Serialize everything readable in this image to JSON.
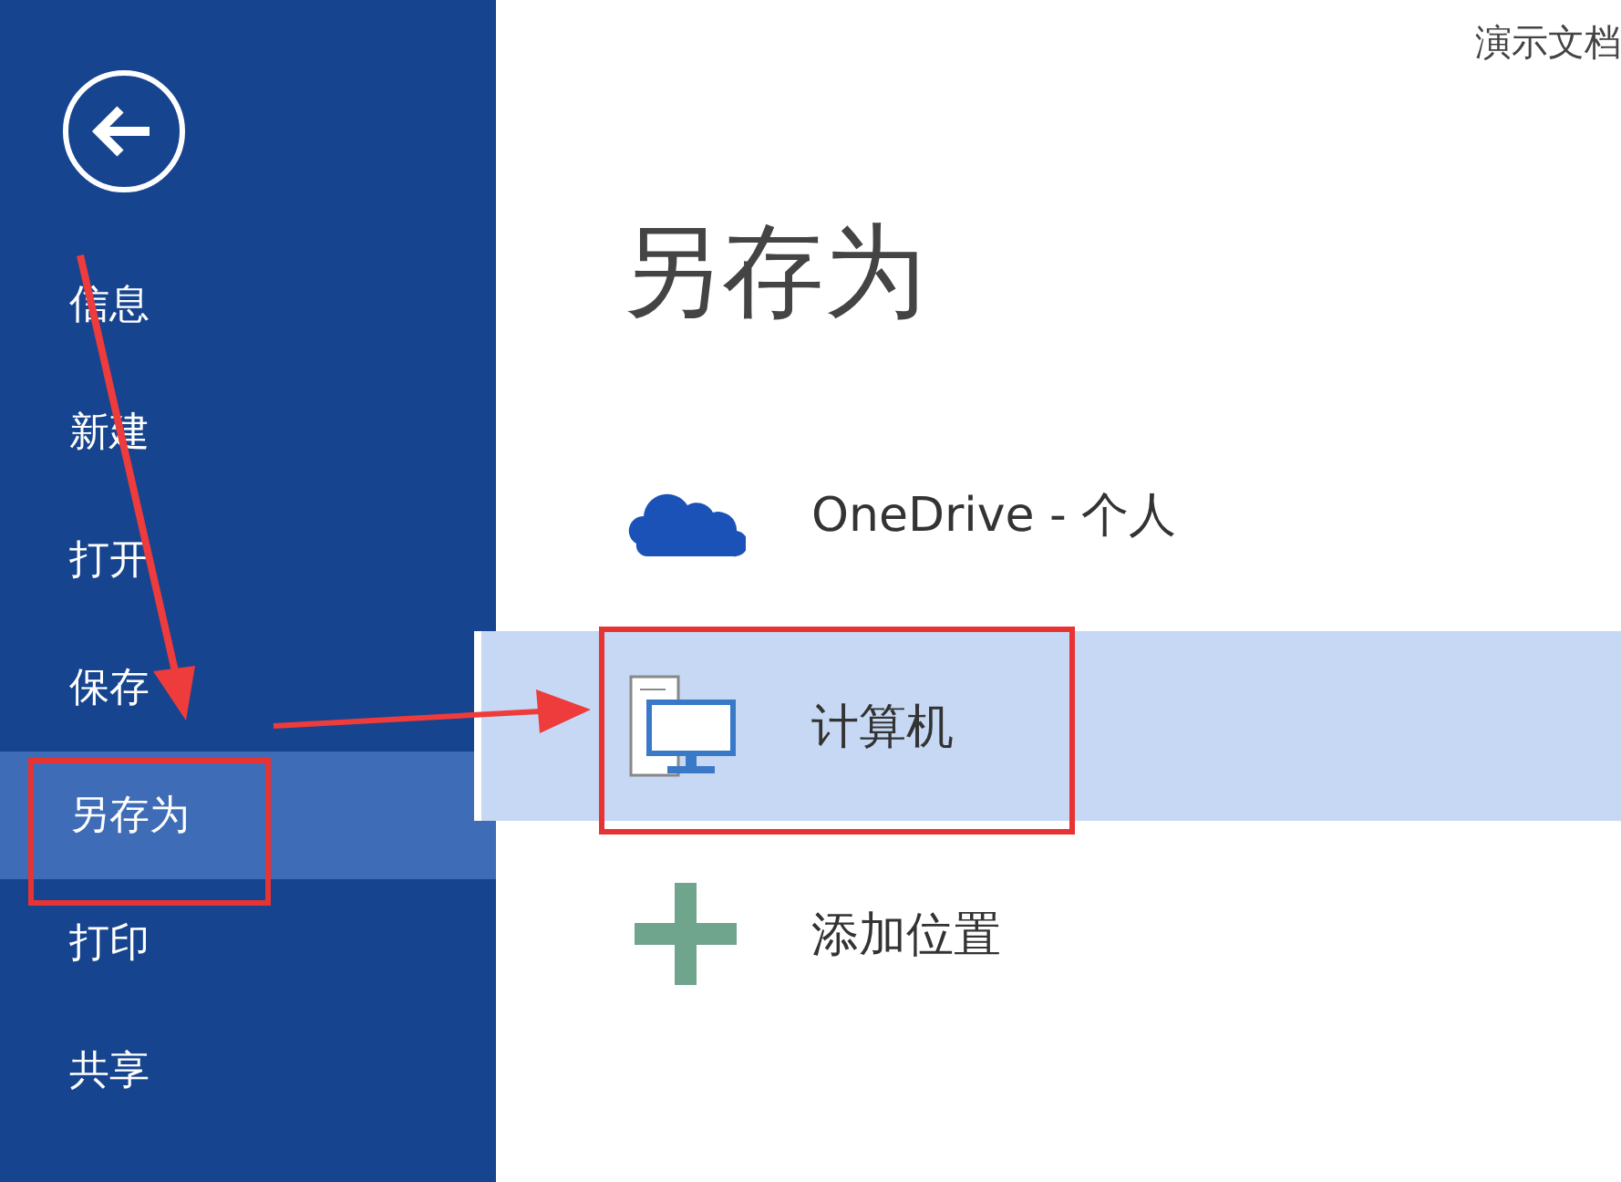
{
  "document_title": "演示文档",
  "sidebar": {
    "items": [
      {
        "label": "信息",
        "selected": false
      },
      {
        "label": "新建",
        "selected": false
      },
      {
        "label": "打开",
        "selected": false
      },
      {
        "label": "保存",
        "selected": false
      },
      {
        "label": "另存为",
        "selected": true
      },
      {
        "label": "打印",
        "selected": false
      },
      {
        "label": "共享",
        "selected": false
      }
    ]
  },
  "page_title": "另存为",
  "locations": [
    {
      "kind": "onedrive",
      "label": "OneDrive - 个人",
      "selected": false
    },
    {
      "kind": "computer",
      "label": "计算机",
      "selected": true
    },
    {
      "kind": "add",
      "label": "添加位置",
      "selected": false
    }
  ]
}
